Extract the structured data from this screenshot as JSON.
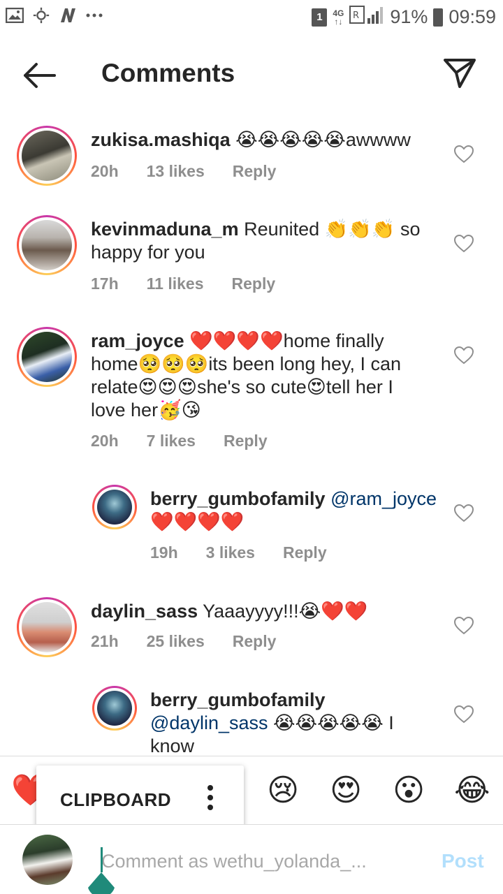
{
  "status_bar": {
    "sim_slot": "1",
    "network_top": "4G",
    "network_bottom": "↑↓",
    "battery": "91%",
    "time": "09:59"
  },
  "header": {
    "title": "Comments"
  },
  "comments": [
    {
      "username": "zukisa.mashiqa",
      "text": " 😭😭😭😭😭awwww",
      "time": "20h",
      "likes": "13 likes",
      "reply": "Reply"
    },
    {
      "username": "kevinmaduna_m",
      "text": " Reunited 👏👏👏 so happy for you",
      "time": "17h",
      "likes": "11 likes",
      "reply": "Reply"
    },
    {
      "username": "ram_joyce",
      "text": " ❤️❤️❤️❤️home finally home🥺🥺🥺its been long hey, I can relate😍😍😍she's so cute😍tell her I love her🥳😘",
      "time": "20h",
      "likes": "7 likes",
      "reply": "Reply"
    },
    {
      "username": "berry_gumbofamily",
      "mention": "@ram_joyce",
      "text": " ❤️❤️❤️❤️",
      "time": "19h",
      "likes": "3 likes",
      "reply": "Reply"
    },
    {
      "username": "daylin_sass",
      "text": " Yaaayyyy!!!😭❤️❤️",
      "time": "21h",
      "likes": "25 likes",
      "reply": "Reply"
    },
    {
      "username": "berry_gumbofamily",
      "mention": "@daylin_sass",
      "text": " 😭😭😭😭😭 I know"
    }
  ],
  "emoji_bar": {
    "items": [
      "❤️",
      "😢",
      "😍",
      "😮",
      "😂"
    ]
  },
  "clipboard": {
    "label": "CLIPBOARD"
  },
  "input": {
    "placeholder": "Comment as wethu_yolanda_...",
    "post_label": "Post"
  },
  "colors": {
    "link": "#003569",
    "muted": "#8e8e8e",
    "post_disabled": "#b2dffc",
    "cursor": "#1f8a7a"
  }
}
